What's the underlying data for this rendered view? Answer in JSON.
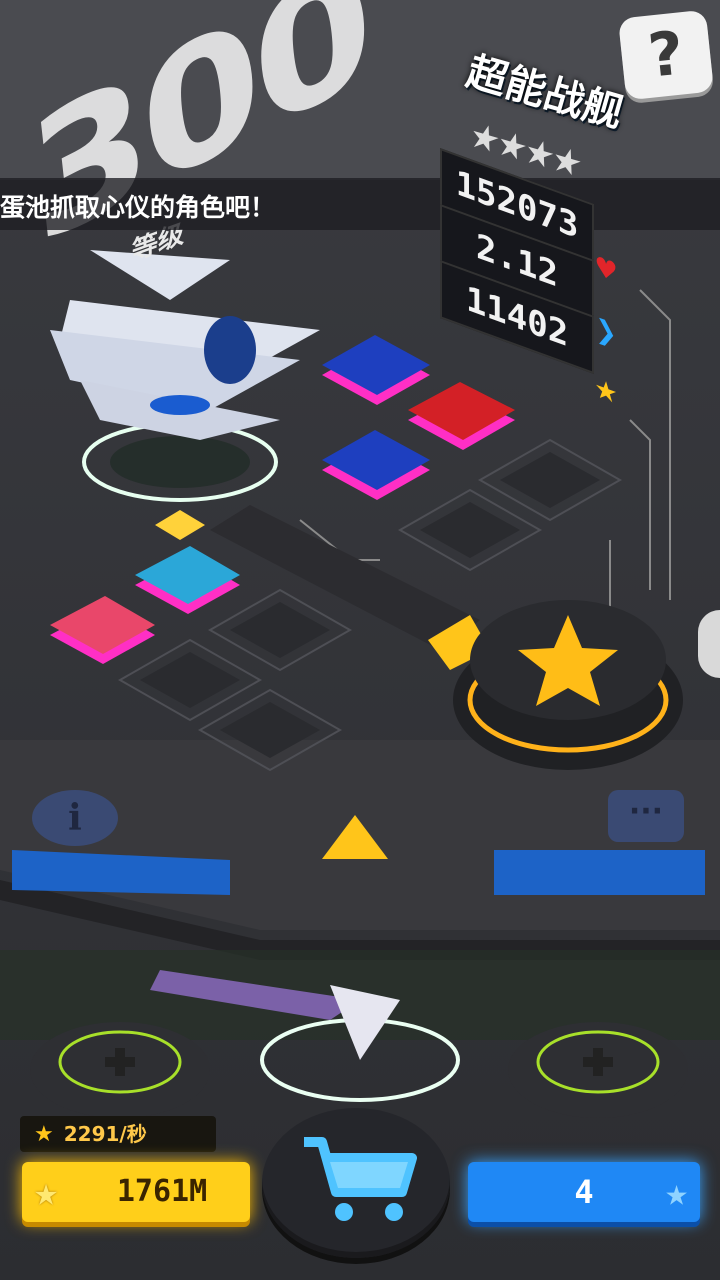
{
  "level": {
    "number": "300",
    "label": "等级"
  },
  "marquee_text": "蛋池抓取心仪的角色吧！",
  "help_icon": "question-mark-icon",
  "ship": {
    "name": "超能战舰",
    "stars": "★★★★"
  },
  "stats": [
    {
      "value": "152073",
      "icon": "heart-icon",
      "color": "#e1252a"
    },
    {
      "value": "2.12",
      "icon": "chevron-right-icon",
      "color": "#2aa7ff"
    },
    {
      "value": "11402",
      "icon": "star-icon",
      "color": "#ffc51a"
    }
  ],
  "info_icon": "info-icon",
  "chat_icon": "chat-bubble-icon",
  "rate": {
    "value": "2291/秒"
  },
  "coins": {
    "value": "1761M"
  },
  "gems": {
    "value": "4"
  },
  "colors": {
    "gold": "#ffcf1a",
    "blue": "#1f88f5",
    "accent_yellow": "#ffc51a"
  }
}
